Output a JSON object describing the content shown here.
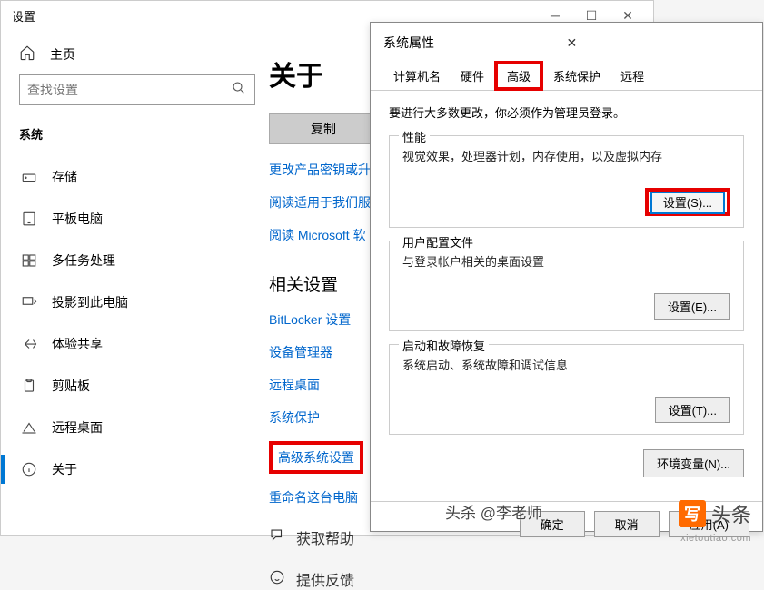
{
  "settings": {
    "title": "设置",
    "home": "主页",
    "search_placeholder": "查找设置",
    "section": "系统",
    "nav": {
      "storage": "存储",
      "tablet": "平板电脑",
      "multitask": "多任务处理",
      "project": "投影到此电脑",
      "experience": "体验共享",
      "clipboard": "剪贴板",
      "remote": "远程桌面",
      "about": "关于"
    }
  },
  "content": {
    "heading": "关于",
    "copy": "复制",
    "links": {
      "change_key": "更改产品密钥或升",
      "read_services": "阅读适用于我们服",
      "read_ms": "阅读 Microsoft 软"
    },
    "related_label": "相关设置",
    "related": {
      "bitlocker": "BitLocker 设置",
      "device_mgr": "设备管理器",
      "remote_desktop": "远程桌面",
      "sys_protect": "系统保护",
      "adv_sys": "高级系统设置",
      "rename": "重命名这台电脑"
    },
    "help": "获取帮助",
    "feedback": "提供反馈"
  },
  "dialog": {
    "title": "系统属性",
    "tabs": {
      "computer": "计算机名",
      "hardware": "硬件",
      "advanced": "高级",
      "protect": "系统保护",
      "remote": "远程"
    },
    "notice": "要进行大多数更改，你必须作为管理员登录。",
    "perf": {
      "legend": "性能",
      "desc": "视觉效果，处理器计划，内存使用，以及虚拟内存",
      "btn": "设置(S)..."
    },
    "profile": {
      "legend": "用户配置文件",
      "desc": "与登录帐户相关的桌面设置",
      "btn": "设置(E)..."
    },
    "startup": {
      "legend": "启动和故障恢复",
      "desc": "系统启动、系统故障和调试信息",
      "btn": "设置(T)..."
    },
    "env": "环境变量(N)...",
    "ok": "确定",
    "cancel": "取消",
    "apply": "应用(A)"
  },
  "watermark": {
    "kill": "头杀 @李老师",
    "badge": "写",
    "brand": "头条",
    "url": "xietoutiao.com"
  }
}
